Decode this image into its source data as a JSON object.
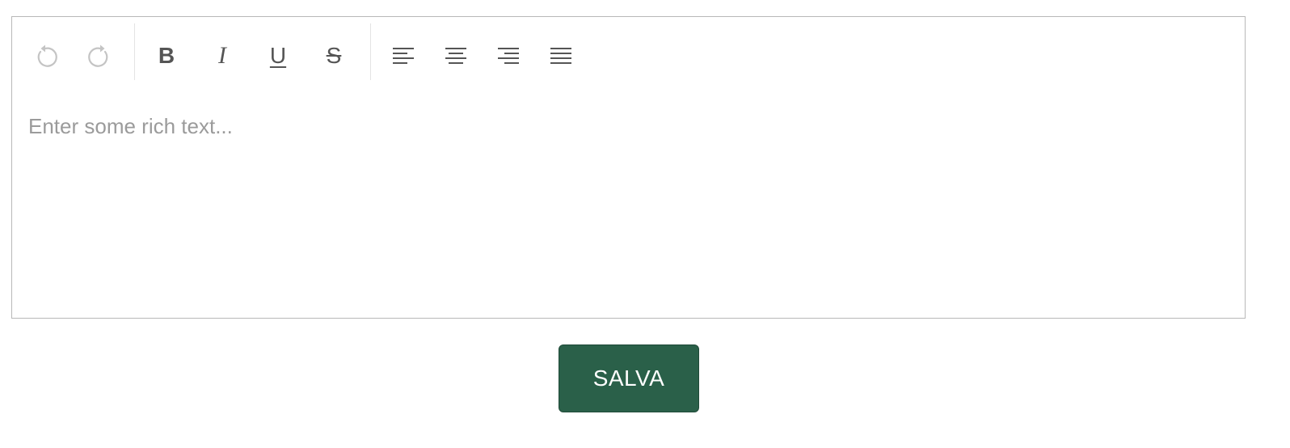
{
  "editor": {
    "placeholder": "Enter some rich text...",
    "content": ""
  },
  "toolbar": {
    "history": [
      {
        "name": "undo",
        "icon": "undo-icon",
        "enabled": false
      },
      {
        "name": "redo",
        "icon": "redo-icon",
        "enabled": false
      }
    ],
    "formatting": [
      {
        "name": "bold",
        "label": "B",
        "icon": "bold-icon"
      },
      {
        "name": "italic",
        "label": "I",
        "icon": "italic-icon"
      },
      {
        "name": "underline",
        "label": "U",
        "icon": "underline-icon"
      },
      {
        "name": "strikethrough",
        "label": "S",
        "icon": "strikethrough-icon"
      }
    ],
    "alignment": [
      {
        "name": "align-left",
        "icon": "align-left-icon"
      },
      {
        "name": "align-center",
        "icon": "align-center-icon"
      },
      {
        "name": "align-right",
        "icon": "align-right-icon"
      },
      {
        "name": "align-justify",
        "icon": "align-justify-icon"
      }
    ]
  },
  "save_button": {
    "label": "SALVA"
  },
  "colors": {
    "save_button_bg": "#2a6049",
    "icon_active": "#555555",
    "icon_disabled": "#c4c4c4",
    "border": "#b8b8b8",
    "placeholder": "#9b9b9b"
  }
}
